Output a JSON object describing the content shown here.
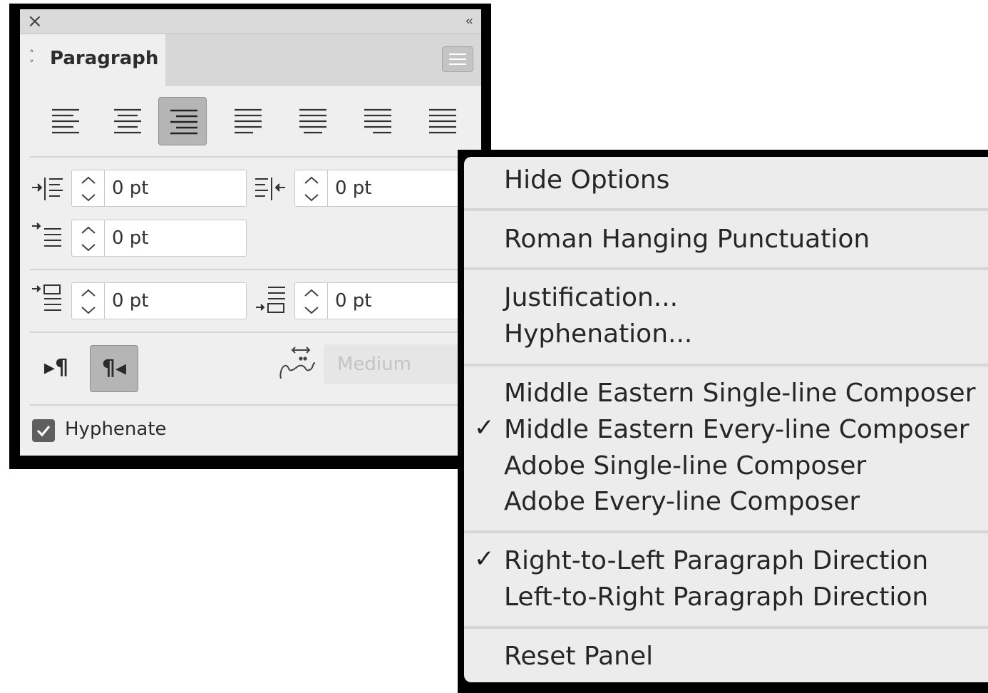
{
  "panel": {
    "close_icon": "close-icon",
    "collapse_icon": "collapse-icon",
    "collapse_text": "‹‹",
    "tab_label": "Paragraph",
    "menu_icon": "hamburger-menu-icon",
    "alignment_buttons": [
      {
        "name": "align-left",
        "active": false
      },
      {
        "name": "align-center",
        "active": false
      },
      {
        "name": "align-right",
        "active": true
      },
      {
        "name": "justify-last-left",
        "active": false
      },
      {
        "name": "justify-last-center",
        "active": false
      },
      {
        "name": "justify-last-right",
        "active": false
      },
      {
        "name": "justify-all",
        "active": false
      }
    ],
    "left_indent": "0 pt",
    "right_indent": "0 pt",
    "first_line_indent": "0 pt",
    "space_before": "0 pt",
    "space_after": "0 pt",
    "direction_ltr_glyph": "▸¶",
    "direction_rtl_glyph": "¶◂",
    "direction_selected": "rtl",
    "kashida_value": "Medium",
    "hyphenate_label": "Hyphenate",
    "hyphenate_checked": true
  },
  "menu": {
    "check_glyph": "✓",
    "items": {
      "hide_options": "Hide Options",
      "roman_hanging_punctuation": "Roman Hanging Punctuation",
      "justification": "Justification...",
      "hyphenation": "Hyphenation...",
      "me_single_line": "Middle Eastern Single-line Composer",
      "me_every_line": "Middle Eastern Every-line Composer",
      "adobe_single_line": "Adobe Single-line Composer",
      "adobe_every_line": "Adobe Every-line Composer",
      "rtl_direction": "Right-to-Left Paragraph Direction",
      "ltr_direction": "Left-to-Right Paragraph Direction",
      "reset_panel": "Reset Panel"
    },
    "checked_items": [
      "me_every_line",
      "rtl_direction"
    ]
  }
}
